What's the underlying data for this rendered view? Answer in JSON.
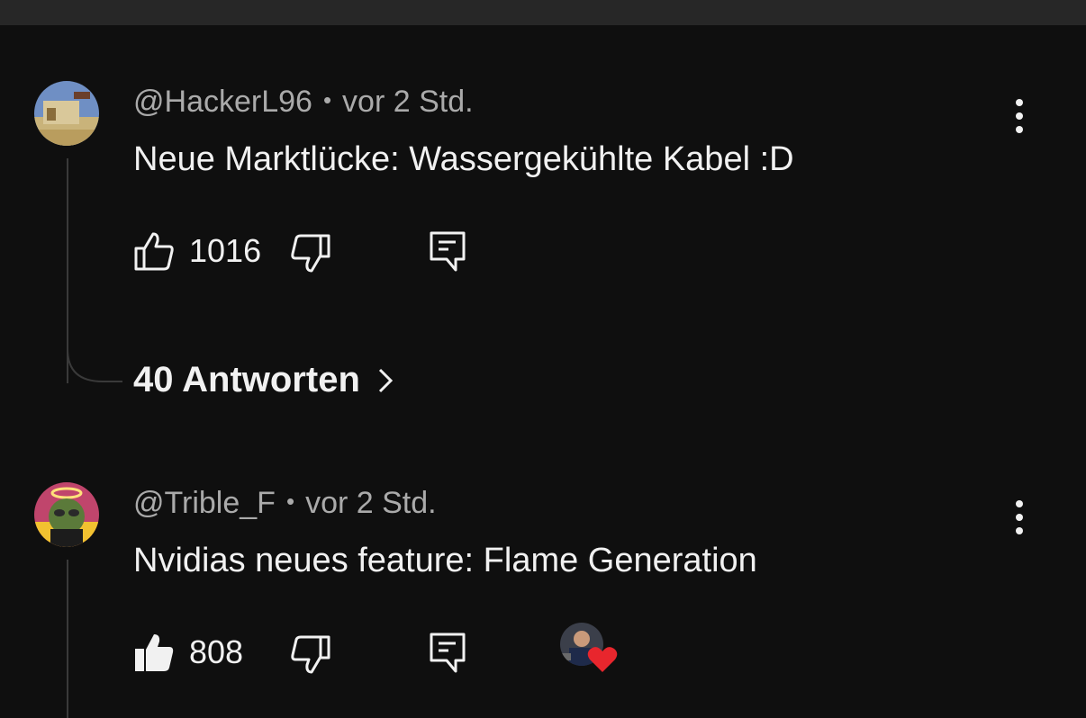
{
  "comments": [
    {
      "author": "@HackerL96",
      "time": "vor 2 Std.",
      "text": "Neue Marktlücke: Wassergekühlte Kabel :D",
      "likes": "1016",
      "liked": false,
      "replies_label": "40 Antworten"
    },
    {
      "author": "@Trible_F",
      "time": "vor 2 Std.",
      "text": "Nvidias neues feature: Flame Generation",
      "likes": "808",
      "liked": true,
      "creator_hearted": true
    }
  ],
  "icons": {
    "like": "thumb-up-icon",
    "dislike": "thumb-down-icon",
    "reply": "reply-comment-icon",
    "more": "more-vert-icon",
    "replies_chevron": "chevron-right-icon",
    "heart": "heart-icon"
  },
  "colors": {
    "background": "#0f0f0f",
    "topbar": "#272727",
    "text_primary": "#f1f1f1",
    "text_secondary": "#aaaaaa",
    "heart": "#e8262d"
  }
}
